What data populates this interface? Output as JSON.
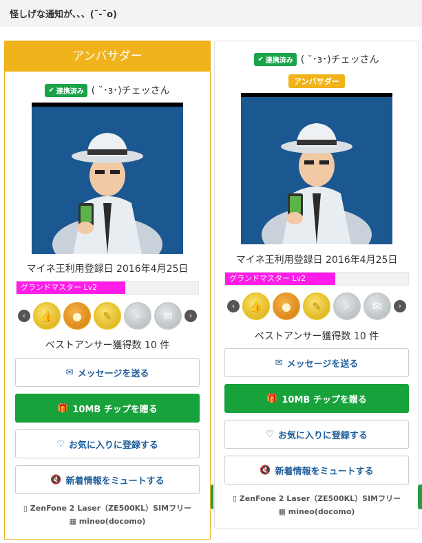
{
  "header": {
    "title": "怪しげな通知が、、、(¯-¯o)"
  },
  "cards": [
    {
      "header_label": "アンバサダー",
      "linked_label": "連携済み",
      "user_name": "( ˘･з･)チェッさん",
      "registration": "マイネ王利用登録日 2016年4月25日",
      "level_label": "グランドマスター Lv2",
      "level_progress": 0.6,
      "best_answer": "ベストアンサー獲得数 10 件",
      "buttons": {
        "message": "メッセージを送る",
        "chip": "10MB チップを贈る",
        "favorite": "お気に入りに登録する",
        "mute": "新着情報をミュートする"
      },
      "device": "ZenFone 2 Laser（ZE500KL）SIMフリー",
      "carrier": "mineo(docomo)"
    },
    {
      "linked_label": "連携済み",
      "user_name": "( ˘･з･)チェッさん",
      "badge": "アンバサダー",
      "registration": "マイネ王利用登録日 2016年4月25日",
      "level_label": "グランドマスター Lv2",
      "level_progress": 0.6,
      "best_answer": "ベストアンサー獲得数 10 件",
      "buttons": {
        "message": "メッセージを送る",
        "chip": "10MB チップを贈る",
        "favorite": "お気に入りに登録する",
        "mute": "新着情報をミュートする"
      },
      "device": "ZenFone 2 Laser（ZE500KL）SIMフリー",
      "carrier": "mineo(docomo)"
    }
  ],
  "colors": {
    "accent_gold": "#f0b31c",
    "linked_green": "#1aa34a",
    "chip_green": "#17a23b",
    "level_pink": "#ff1ce8",
    "avatar_blue": "#1b5791",
    "link_blue": "#1f5d9a"
  },
  "icons": {
    "message": "envelope-icon",
    "chip": "gift-icon",
    "favorite": "heart-icon",
    "mute": "speaker-mute-icon",
    "device": "phone-icon",
    "carrier": "building-icon",
    "nav_prev": "chevron-left-icon",
    "nav_next": "chevron-right-icon",
    "medals": [
      "thumbs-up-medal-icon",
      "coins-medal-icon",
      "pen-medal-icon",
      "magnifier-medal-icon",
      "chat-medal-icon"
    ]
  }
}
